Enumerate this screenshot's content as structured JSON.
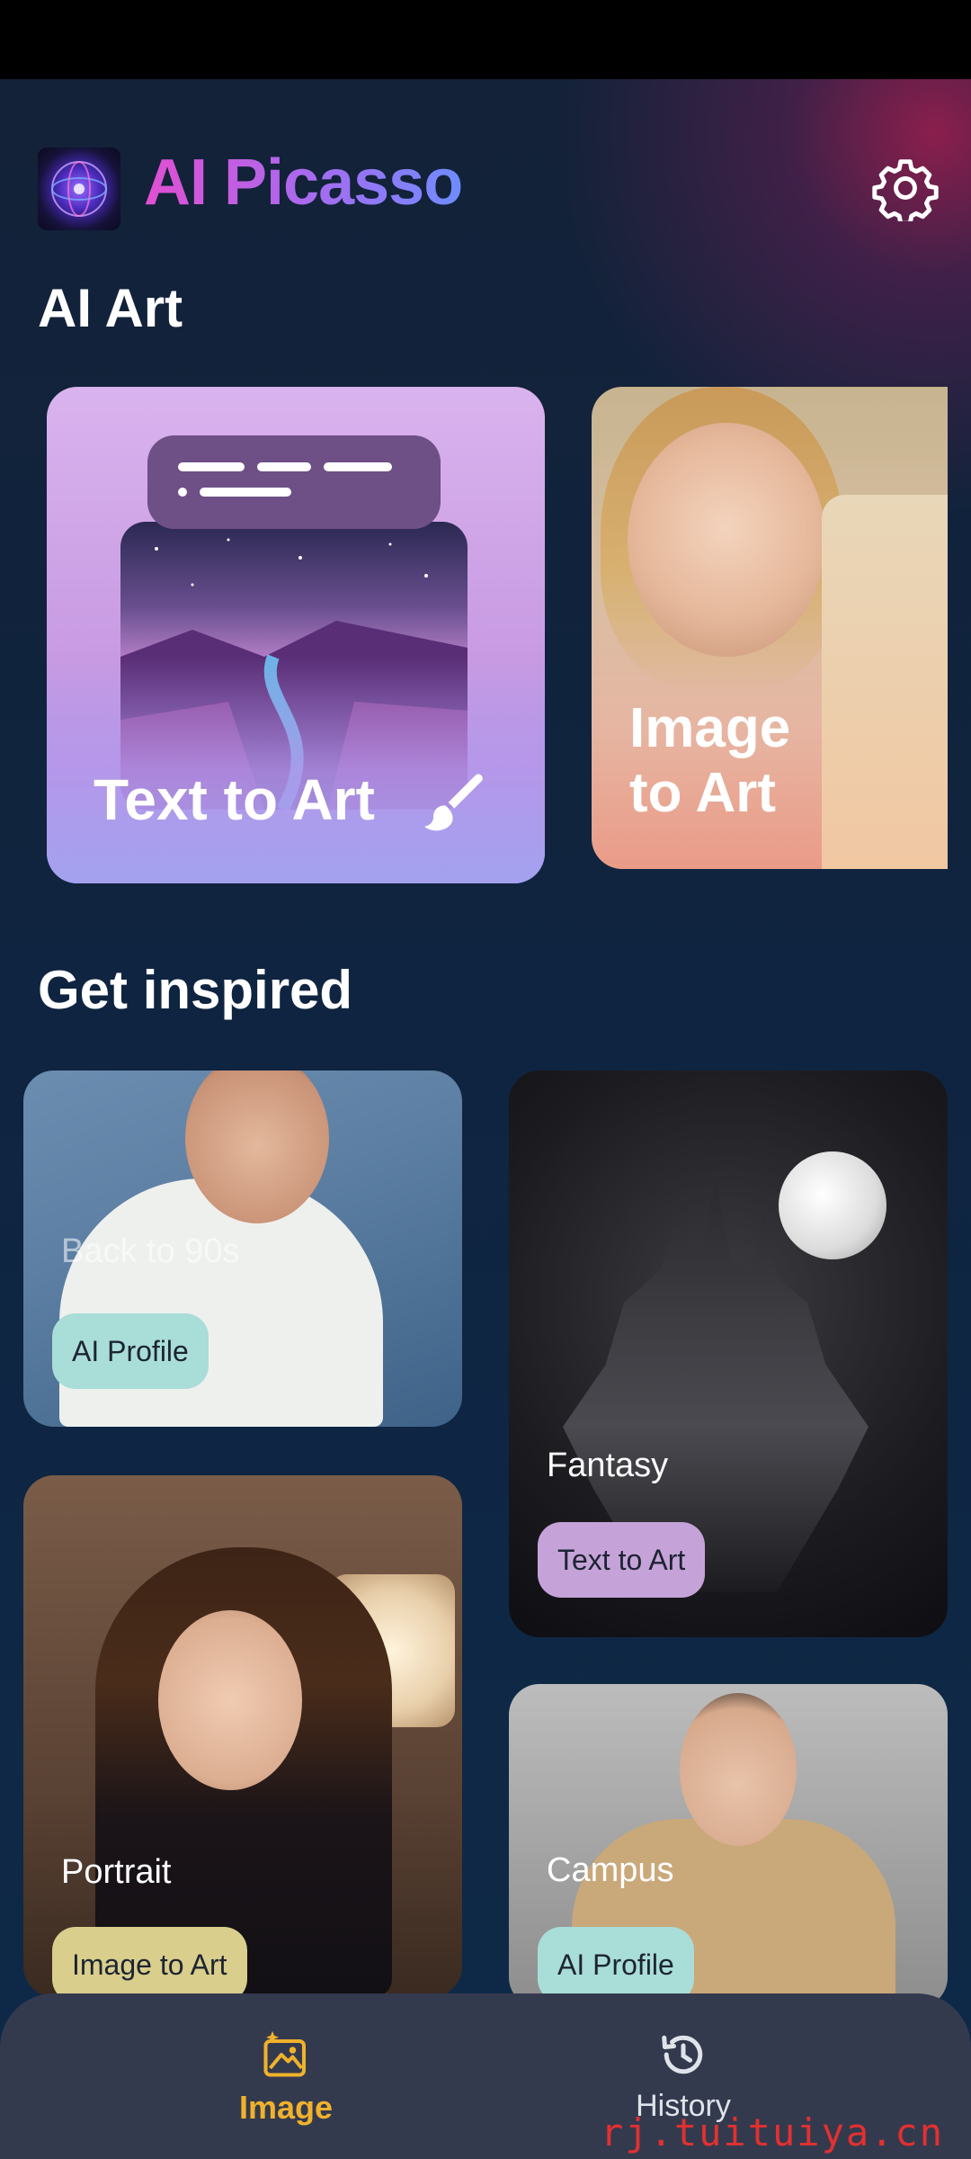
{
  "header": {
    "app_title": "AI Picasso",
    "logo_icon": "orb-logo-icon",
    "settings_icon": "gear-icon"
  },
  "sections": {
    "ai_art_title": "AI Art",
    "inspired_title": "Get inspired"
  },
  "features": [
    {
      "label": "Text to Art",
      "icon": "paintbrush-icon"
    },
    {
      "label": "Image\nto Art"
    }
  ],
  "inspiration": [
    {
      "caption": "Back to 90s",
      "tag": "AI Profile"
    },
    {
      "caption": "Fantasy",
      "tag": "Text to Art"
    },
    {
      "caption": "Portrait",
      "tag": "Image to Art"
    },
    {
      "caption": "Campus",
      "tag": "AI Profile"
    }
  ],
  "bottom_nav": {
    "image_label": "Image",
    "history_label": "History",
    "active": "Image"
  },
  "watermark": "rj.tuituiya.cn",
  "colors": {
    "accent": "#f0b22c",
    "title_gradient_start": "#e24fd2",
    "title_gradient_end": "#6f8cff",
    "tag_teal": "#a9ddd8",
    "tag_purple": "#c5a3d8",
    "tag_olive": "#d9ce8b"
  }
}
